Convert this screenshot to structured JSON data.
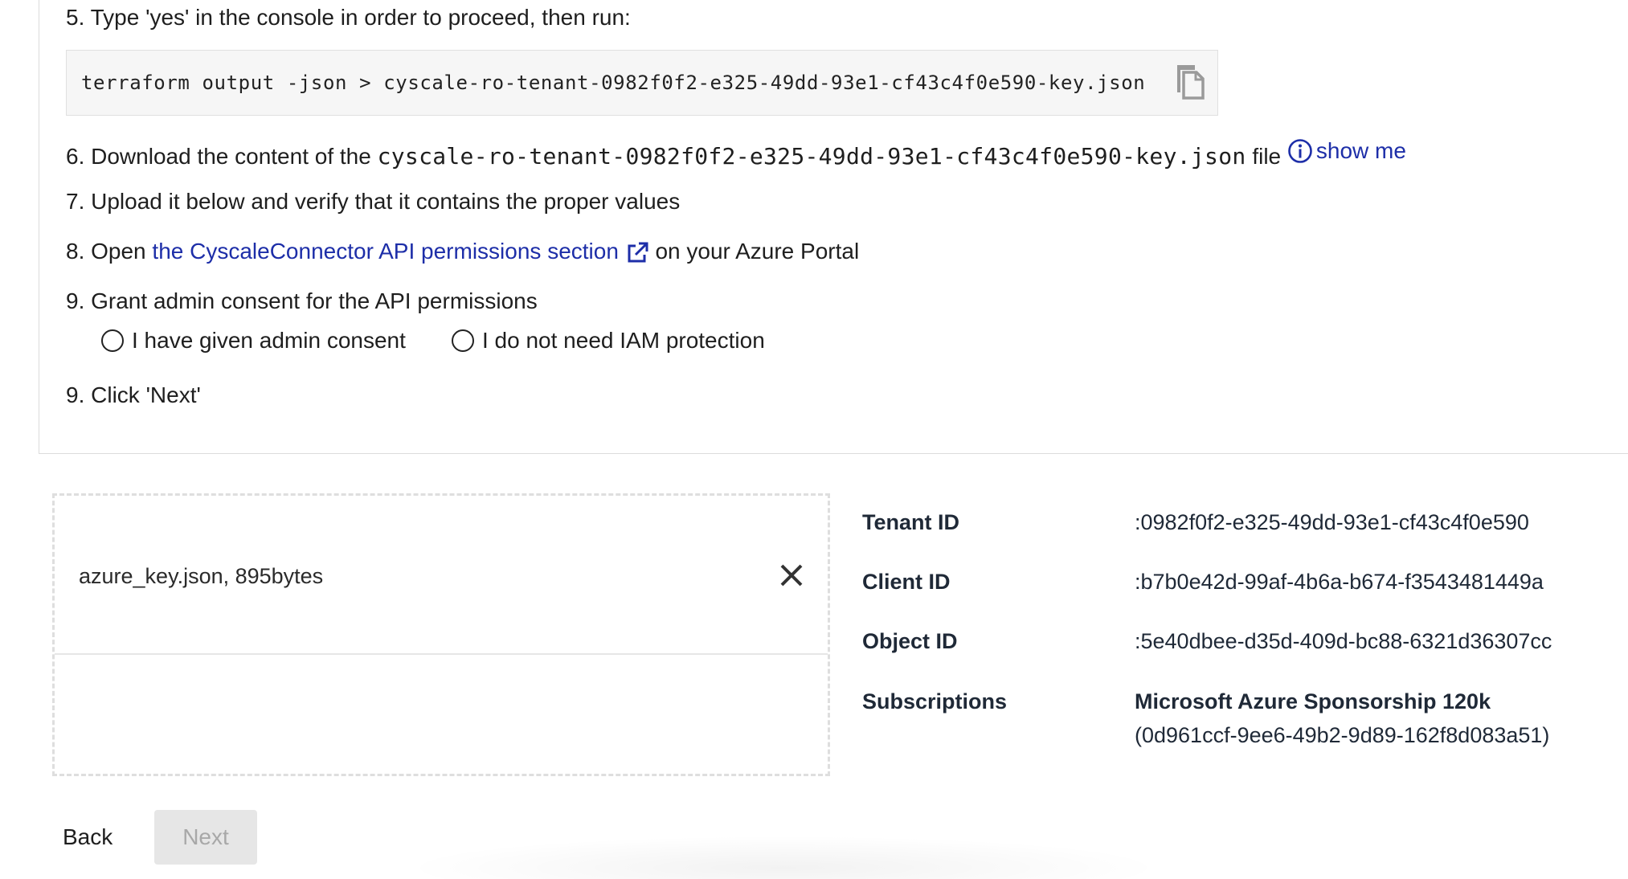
{
  "steps": {
    "step5": "5. Type 'yes' in the console in order to proceed, then run:",
    "command": "terraform output -json > cyscale-ro-tenant-0982f0f2-e325-49dd-93e1-cf43c4f0e590-key.json",
    "step6_prefix": "6. Download the content of the",
    "step6_filename": "cyscale-ro-tenant-0982f0f2-e325-49dd-93e1-cf43c4f0e590-key.json",
    "step6_suffix": "file",
    "show_me": "show me",
    "step7": "7. Upload it below and verify that it contains the proper values",
    "step8_prefix": "8. Open",
    "step8_link": "the CyscaleConnector API permissions section",
    "step8_suffix": "on your Azure Portal",
    "step9": "9. Grant admin consent for the API permissions",
    "radio_consent": "I have given admin consent",
    "radio_no_iam": "I do not need IAM protection",
    "step10": "9. Click 'Next'"
  },
  "upload": {
    "file_label": "azure_key.json, 895bytes"
  },
  "key_info": {
    "tenant_label": "Tenant ID",
    "tenant_value": ":0982f0f2-e325-49dd-93e1-cf43c4f0e590",
    "client_label": "Client ID",
    "client_value": ":b7b0e42d-99af-4b6a-b674-f3543481449a",
    "object_label": "Object ID",
    "object_value": ":5e40dbee-d35d-409d-bc88-6321d36307cc",
    "subscriptions_label": "Subscriptions",
    "subscription_name": "Microsoft Azure Sponsorship 120k",
    "subscription_id": "(0d961ccf-9ee6-49b2-9d89-162f8d083a51)"
  },
  "nav": {
    "back": "Back",
    "next": "Next"
  },
  "icons": {
    "copy": "copy-icon",
    "info": "info-icon",
    "external_link": "external-link-icon",
    "close": "close-icon"
  },
  "colors": {
    "link": "#1d2ea8",
    "code_bg": "#f6f6f6",
    "disabled_button_bg": "#e6e6e6"
  }
}
